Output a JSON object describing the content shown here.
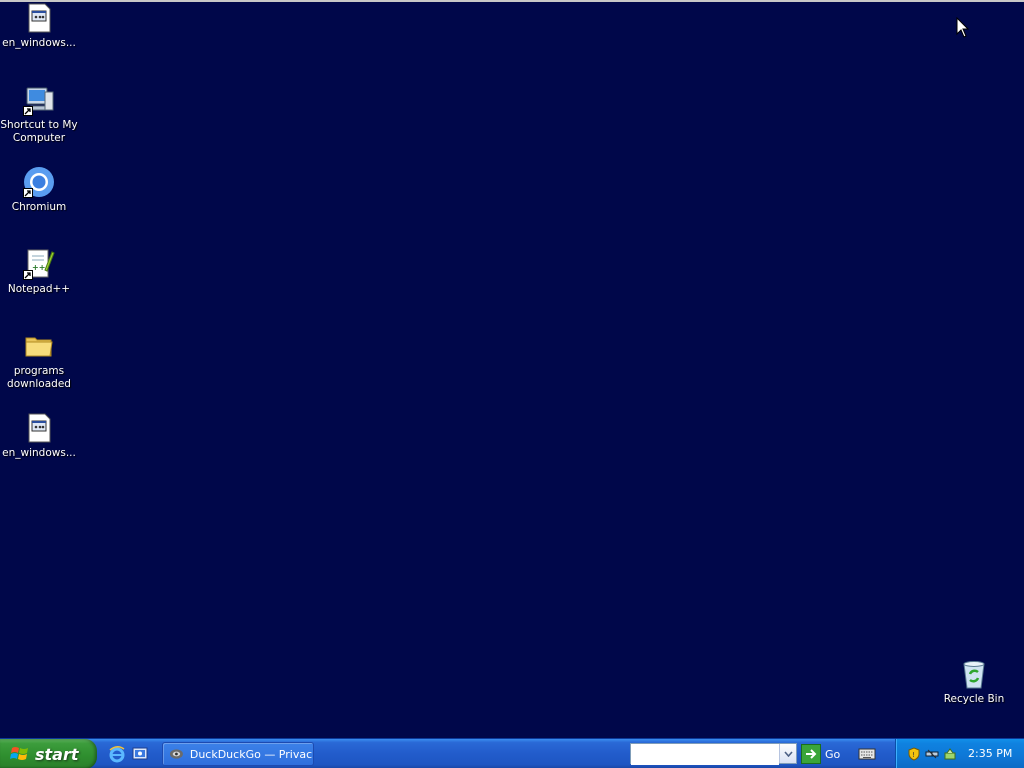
{
  "desktop": {
    "background": "#00074a",
    "icons": [
      {
        "label": "en_windows...",
        "icon": "installer-file-icon"
      },
      {
        "label": "Shortcut to My\nComputer",
        "icon": "my-computer-shortcut-icon"
      },
      {
        "label": "Chromium",
        "icon": "chromium-icon"
      },
      {
        "label": "Notepad++",
        "icon": "notepadpp-icon"
      },
      {
        "label": "programs\ndownloaded",
        "icon": "folder-icon"
      },
      {
        "label": "en_windows...",
        "icon": "installer-file-icon"
      },
      {
        "label": "Recycle Bin",
        "icon": "recycle-bin-icon"
      }
    ]
  },
  "taskbar": {
    "start_label": "start",
    "task_window_label": "DuckDuckGo — Privac...",
    "address_value": "",
    "go_label": "Go",
    "clock": "2:35 PM"
  },
  "colors": {
    "taskbar_blue": "#225ccb",
    "start_green": "#3c9c3c",
    "tray_blue": "#0e77d6"
  }
}
